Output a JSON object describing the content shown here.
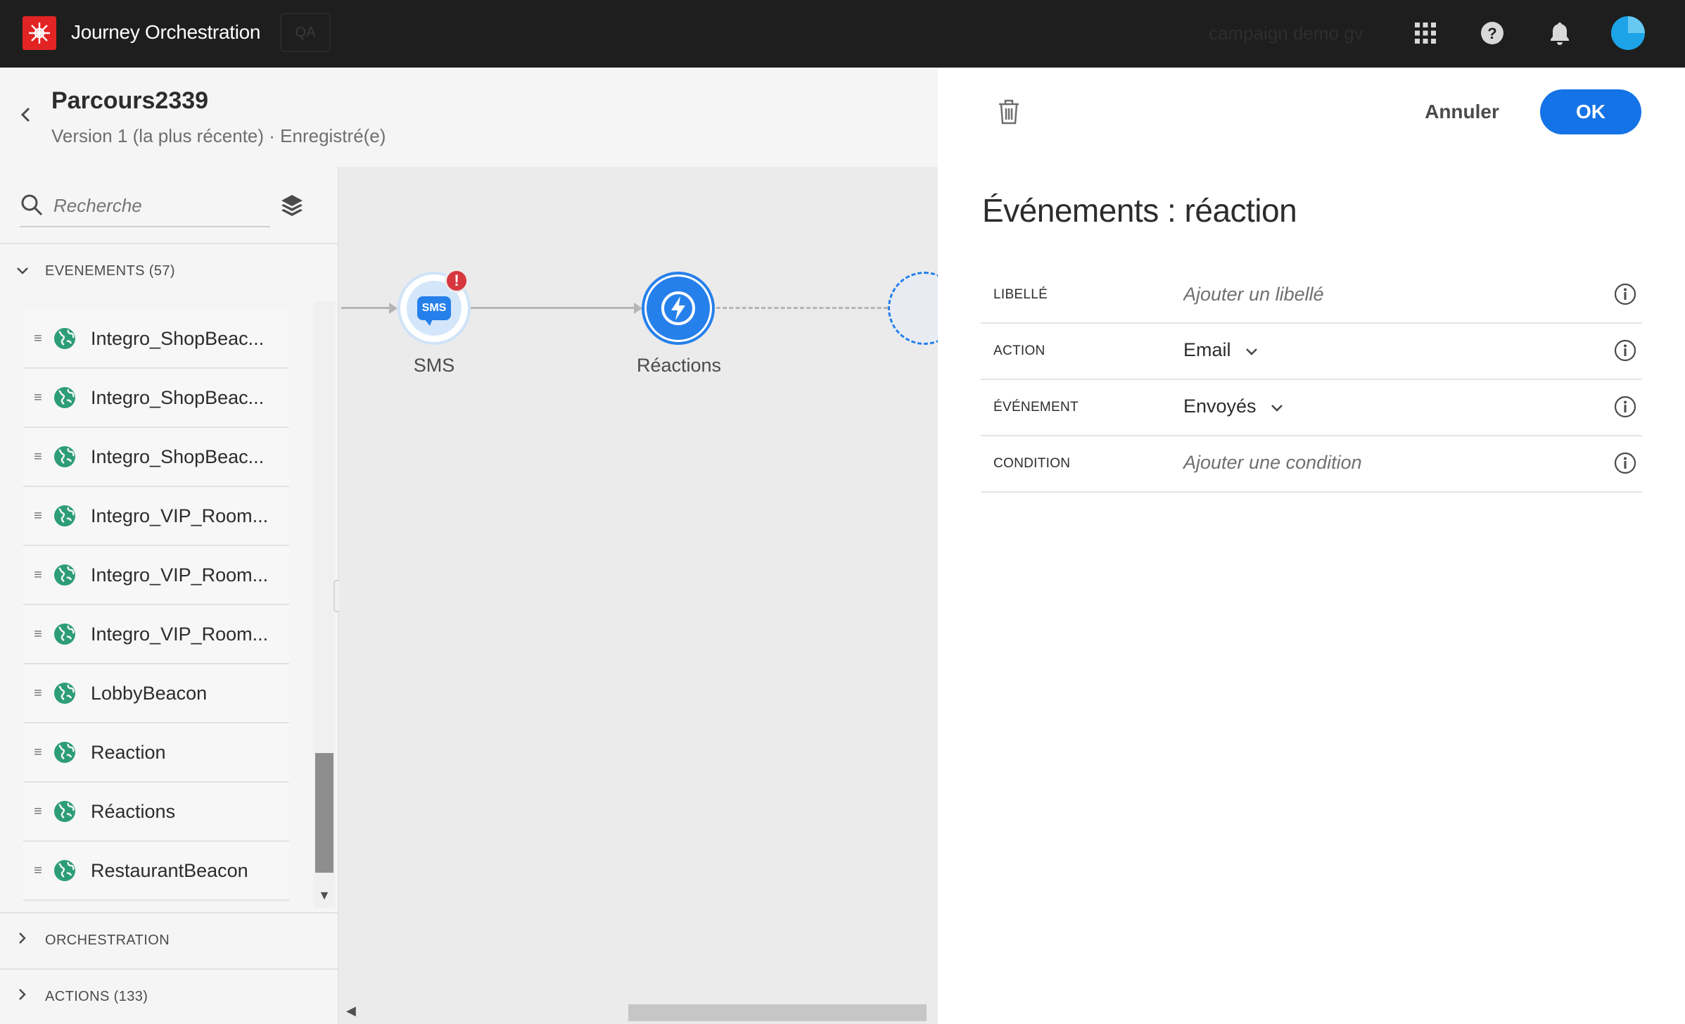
{
  "topbar": {
    "app_title": "Journey Orchestration",
    "env_badge": "QA",
    "org_name": "campaign demo gv"
  },
  "journey": {
    "name": "Parcours2339",
    "version": "Version 1 (la plus récente) · Enregistré(e)"
  },
  "palette": {
    "search_placeholder": "Recherche",
    "sections": {
      "events": "EVENEMENTS (57)",
      "orchestration": "ORCHESTRATION",
      "actions": "ACTIONS (133)"
    },
    "event_items": [
      {
        "label": "Integro_ShopBeac..."
      },
      {
        "label": "Integro_ShopBeac..."
      },
      {
        "label": "Integro_ShopBeac..."
      },
      {
        "label": "Integro_VIP_Room..."
      },
      {
        "label": "Integro_VIP_Room..."
      },
      {
        "label": "Integro_VIP_Room..."
      },
      {
        "label": "LobbyBeacon"
      },
      {
        "label": "Reaction"
      },
      {
        "label": "Réactions"
      },
      {
        "label": "RestaurantBeacon"
      }
    ]
  },
  "canvas": {
    "nodes": {
      "sms_label": "SMS",
      "sms_icon_text": "SMS",
      "sms_error": "!",
      "reactions_label": "Réactions"
    }
  },
  "panel": {
    "cancel_label": "Annuler",
    "ok_label": "OK",
    "title": "Événements : réaction",
    "rows": {
      "label_key": "LIBELLÉ",
      "label_placeholder": "Ajouter un libellé",
      "action_key": "ACTION",
      "action_value": "Email",
      "event_key": "ÉVÉNEMENT",
      "event_value": "Envoyés",
      "condition_key": "CONDITION",
      "condition_placeholder": "Ajouter une condition"
    }
  },
  "colors": {
    "topbar_bg": "#1e1e1e",
    "brand_red": "#e22424",
    "accent_blue": "#1473e6",
    "node_blue": "#2680eb",
    "event_green": "#2d9d78",
    "error_red": "#d7373f"
  },
  "icons": [
    "adobe-logo-icon",
    "apps-grid-icon",
    "help-icon",
    "bell-icon",
    "search-icon",
    "layers-icon",
    "globe-icon",
    "drag-handle-icon",
    "trash-icon",
    "info-icon",
    "chevron-down-icon",
    "lightning-icon"
  ]
}
